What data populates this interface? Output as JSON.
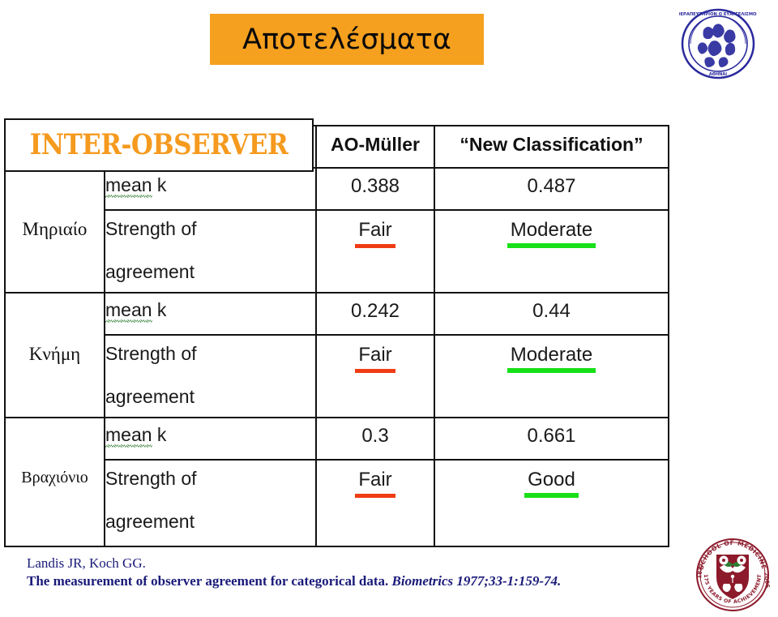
{
  "slide": {
    "title": "Αποτελέσματα",
    "title_bg_color": "#f5a01e",
    "section_label": "INTER-OBSERVER",
    "section_label_color": "#f59a1e"
  },
  "table": {
    "headers": {
      "corner": "INTER-OBSERVER",
      "col_ao": "AO-Müller",
      "col_new": "“New Classification”"
    },
    "metric_labels": {
      "mean_k_prefix": "mean",
      "mean_k_suffix": " k",
      "strength_line1": "Strength of",
      "strength_line2": "agreement"
    },
    "rows": [
      {
        "region": "Μηριαίο",
        "mean_k_ao": "0.388",
        "mean_k_new": "0.487",
        "strength_ao": "Fair",
        "strength_new": "Moderate",
        "strength_ao_color": "#f03c14",
        "strength_new_color": "#18e018"
      },
      {
        "region": "Κνήμη",
        "mean_k_ao": "0.242",
        "mean_k_new": "0.44",
        "strength_ao": "Fair",
        "strength_new": "Moderate",
        "strength_ao_color": "#f03c14",
        "strength_new_color": "#18e018"
      },
      {
        "region": "Βραχιόνιο",
        "mean_k_ao": "0.3",
        "mean_k_new": "0.661",
        "strength_ao": "Fair",
        "strength_new": "Good",
        "strength_ao_color": "#f03c14",
        "strength_new_color": "#18e018"
      }
    ]
  },
  "citation": {
    "authors": "Landis JR, Koch GG.",
    "title": "The measurement of observer agreement for categorical data.",
    "journal": "Biometrics 1977;33-1:159-74.",
    "color": "#1a1a7a"
  },
  "emblems": {
    "university_seal": {
      "name": "university-seal-icon",
      "color": "#2a2a9e",
      "top_text": "ΘΕΡΑΠΕΥΤΗΡΙΟΝ Ο ΕΥΑΓΓΕΛΙΣΜΟΣ",
      "bottom_text": "ΑΘΗΝΑΙ"
    },
    "medicine_emblem": {
      "name": "school-of-medicine-emblem-icon",
      "color": "#8c1a2b",
      "top_text": "SCHOOL OF MEDICINE",
      "bottom_text": "175 YEARS OF ACHIEVEMENT",
      "year_left": "1837",
      "year_right": "2006"
    }
  }
}
